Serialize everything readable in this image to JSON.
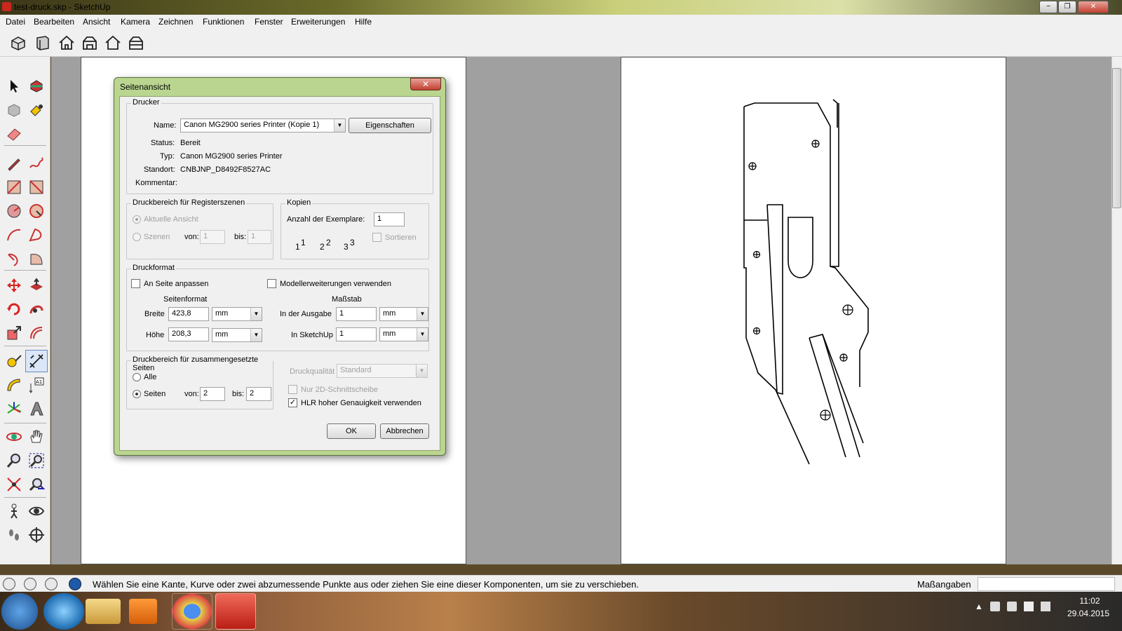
{
  "window": {
    "title": "test-druck.skp - SketchUp",
    "controls": [
      "−",
      "❐",
      "✕"
    ]
  },
  "menu": [
    "Datei",
    "Bearbeiten",
    "Ansicht",
    "Kamera",
    "Zeichnen",
    "Funktionen",
    "Fenster",
    "Erweiterungen",
    "Hilfe"
  ],
  "toolbar_top": [
    "iso-view-icon",
    "top-view-icon",
    "front-view-icon",
    "right-view-icon",
    "back-view-icon",
    "left-view-icon"
  ],
  "dialog": {
    "title": "Seitenansicht",
    "close": "✕",
    "printer": {
      "group": "Drucker",
      "name_label": "Name:",
      "name_value": "Canon MG2900 series Printer (Kopie 1)",
      "properties_button": "Eigenschaften",
      "status_label": "Status:",
      "status_value": "Bereit",
      "type_label": "Typ:",
      "type_value": "Canon MG2900 series Printer",
      "location_label": "Standort:",
      "location_value": "CNBJNP_D8492F8527AC",
      "comment_label": "Kommentar:",
      "comment_value": ""
    },
    "scene_range": {
      "group": "Druckbereich für Registerszenen",
      "current_view": "Aktuelle Ansicht",
      "scenes": "Szenen",
      "from_label": "von:",
      "from_value": "1",
      "to_label": "bis:",
      "to_value": "1"
    },
    "copies": {
      "group": "Kopien",
      "count_label": "Anzahl der Exemplare:",
      "count_value": "1",
      "collate_label": "Sortieren",
      "page_glyphs": [
        "1",
        "1",
        "2",
        "2",
        "3",
        "3"
      ]
    },
    "print_format": {
      "group": "Druckformat",
      "fit_page": "An Seite anpassen",
      "model_extents": "Modellerweiterungen verwenden",
      "page_format_header": "Seitenformat",
      "scale_header": "Maßstab",
      "width_label": "Breite",
      "width_value": "423,8",
      "width_unit": "mm",
      "height_label": "Höhe",
      "height_value": "208,3",
      "height_unit": "mm",
      "output_label": "In der Ausgabe",
      "output_value": "1",
      "output_unit": "mm",
      "sketchup_label": "In SketchUp",
      "sketchup_value": "1",
      "sketchup_unit": "mm"
    },
    "tiled_range": {
      "group": "Druckbereich für zusammengesetzte Seiten",
      "all": "Alle",
      "pages": "Seiten",
      "from_label": "von:",
      "from_value": "2",
      "to_label": "bis:",
      "to_value": "2"
    },
    "quality": {
      "label": "Druckqualität",
      "value": "Standard",
      "only_2d": "Nur 2D-Schnittscheibe",
      "hlr": "HLR hoher Genauigkeit verwenden"
    },
    "ok": "OK",
    "cancel": "Abbrechen"
  },
  "statusbar": {
    "message": "Wählen Sie eine Kante, Kurve oder zwei abzumessende Punkte aus oder ziehen Sie eine dieser Komponenten, um sie zu verschieben.",
    "measure_label": "Maßangaben",
    "measure_value": ""
  },
  "taskbar": {
    "time": "11:02",
    "date": "29.04.2015",
    "apps": [
      "start-orb-icon",
      "internet-explorer-icon",
      "explorer-icon",
      "media-player-icon",
      "chrome-icon",
      "sketchup-icon"
    ]
  },
  "colors": {
    "dialog_frame": "#b9d58f",
    "canvas_bg": "#a0a0a0",
    "page_bg": "#ffffff"
  }
}
